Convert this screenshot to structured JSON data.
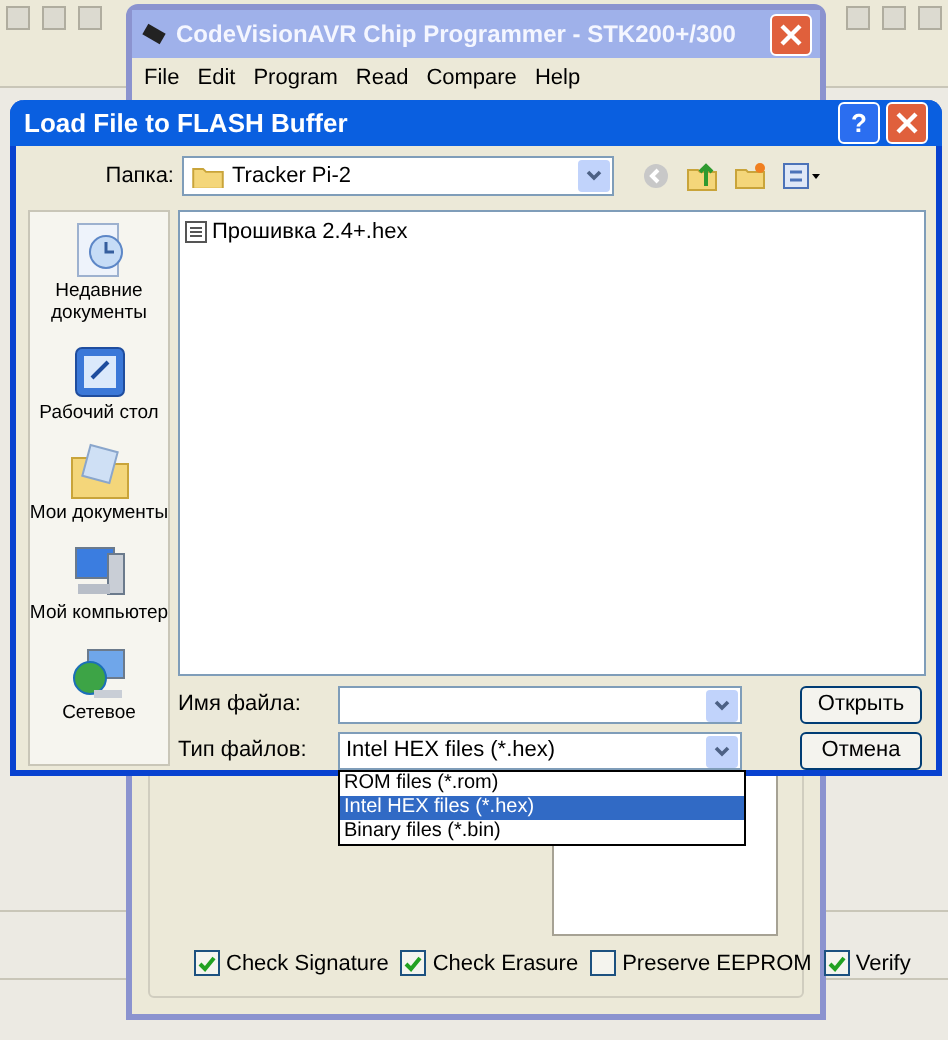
{
  "programmer": {
    "title": "CodeVisionAVR Chip Programmer - STK200+/300",
    "menu": [
      "File",
      "Edit",
      "Program",
      "Read",
      "Compare",
      "Help"
    ],
    "options": [
      {
        "label": "Check Signature",
        "checked": true
      },
      {
        "label": "Check Erasure",
        "checked": true
      },
      {
        "label": "Preserve EEPROM",
        "checked": false
      },
      {
        "label": "Verify",
        "checked": true
      }
    ]
  },
  "dialog": {
    "title": "Load File to FLASH Buffer",
    "help_button": "?",
    "folder_label": "Папка:",
    "folder": "Tracker Pi-2",
    "places": [
      {
        "label": "Недавние документы"
      },
      {
        "label": "Рабочий стол"
      },
      {
        "label": "Мои документы"
      },
      {
        "label": "Мой компьютер"
      },
      {
        "label": "Сетевое"
      }
    ],
    "files": [
      {
        "name": "Прошивка 2.4+.hex"
      }
    ],
    "filename_label": "Имя файла:",
    "filetype_label": "Тип файлов:",
    "filetype": "Intel HEX files (*.hex)",
    "filetype_options": [
      {
        "label": "ROM files (*.rom)",
        "selected": false
      },
      {
        "label": "Intel HEX files (*.hex)",
        "selected": true
      },
      {
        "label": "Binary files (*.bin)",
        "selected": false
      }
    ],
    "buttons": [
      "Открыть",
      "Отмена"
    ]
  }
}
